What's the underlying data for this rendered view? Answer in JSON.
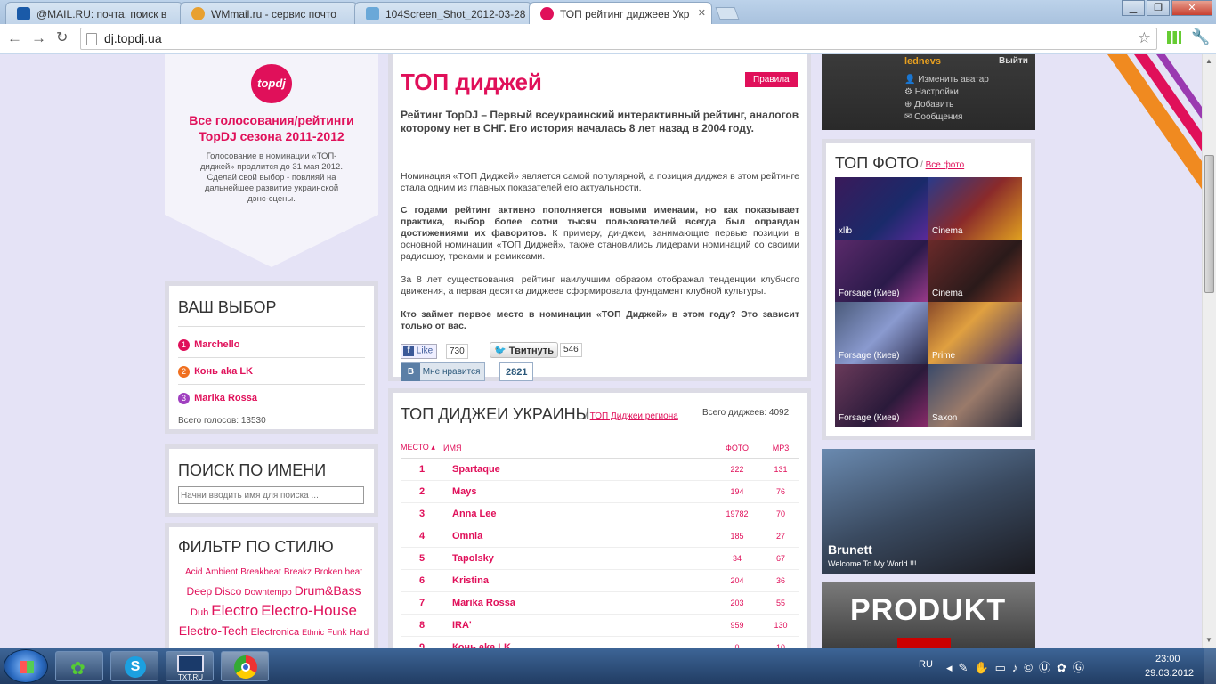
{
  "browser": {
    "tabs": [
      {
        "label": "@MAIL.RU: почта, поиск в"
      },
      {
        "label": "WMmail.ru - сервис почто"
      },
      {
        "label": "104Screen_Shot_2012-03-28"
      },
      {
        "label": "ТОП рейтинг диджеев Укр"
      }
    ],
    "url": "dj.topdj.ua"
  },
  "left": {
    "promo": {
      "logo": "topdj",
      "title": "Все голосования/рейтинги TopDJ сезона 2011-2012",
      "text": "Голосование в номинации «ТОП-диджей» продлится до 31 мая 2012. Сделай свой выбор - повлияй на дальнейшее развитие украинской дэнс-сцены."
    },
    "choice": {
      "title": "ВАШ ВЫБОР",
      "items": [
        {
          "num": "1",
          "name": "Marchello",
          "color": "#e0105a"
        },
        {
          "num": "2",
          "name": "Конь aka LK",
          "color": "#f07020"
        },
        {
          "num": "3",
          "name": "Marika Rossa",
          "color": "#a040c0"
        }
      ],
      "total": "Всего голосов: 13530"
    },
    "search": {
      "title": "ПОИСК ПО ИМЕНИ",
      "placeholder": "Начни вводить имя для поиска ..."
    },
    "filter": {
      "title": "ФИЛЬТР ПО СТИЛЮ",
      "tags": [
        "Acid",
        "Ambient",
        "Breakbeat",
        "Breakz",
        "Broken beat",
        "Deep",
        "Disco",
        "Downtempo",
        "Drum&Bass",
        "Dub",
        "Electro",
        "Electro-House",
        "Electro-Tech",
        "Electronica",
        "Ethnic",
        "Funk",
        "Hard"
      ]
    }
  },
  "main": {
    "title": "ТОП диджей",
    "rules_btn": "Правила",
    "lead": "Рейтинг TopDJ – Первый всеукраинский интерактивный рейтинг, аналогов которому нет в СНГ. Его история началась 8 лет назад в 2004 году.",
    "p1": "Номинация «ТОП Диджей» является самой популярной, а позиция диджея в этом рейтинге стала одним из главных показателей его актуальности.",
    "p2_bold": "С годами рейтинг активно пополняется новыми именами, но как показывает практика, выбор более сотни тысяч пользователей всегда был оправдан достижениями их фаворитов.",
    "p2_rest": " К примеру, ди-джеи, занимающие первые позиции в основной номинации «ТОП Диджей», также становились лидерами номинаций со своими радиошоу, треками и ремиксами.",
    "p3": "За 8 лет существования, рейтинг наилучшим образом отображал тенденции клубного движения, а первая десятка диджеев сформировала фундамент клубной культуры.",
    "p4": "Кто займет первое место в номинации «ТОП Диджей» в этом году? Это зависит только от вас.",
    "social": {
      "fb_label": "Like",
      "fb_count": "730",
      "tw_label": "Твитнуть",
      "tw_count": "546",
      "vk_label": "Мне нравится",
      "vk_count": "2821"
    }
  },
  "ranking": {
    "title": "ТОП ДИДЖЕИ УКРАИНЫ",
    "link": "ТОП Диджеи региона",
    "total": "Всего диджеев: 4092",
    "cols": {
      "place": "МЕСТО",
      "name": "ИМЯ",
      "photo": "ФОТО",
      "mp3": "MP3"
    },
    "rows": [
      {
        "place": "1",
        "name": "Spartaque",
        "photo": "222",
        "mp3": "131"
      },
      {
        "place": "2",
        "name": "Mays",
        "photo": "194",
        "mp3": "76"
      },
      {
        "place": "3",
        "name": "Anna Lee",
        "photo": "19782",
        "mp3": "70"
      },
      {
        "place": "4",
        "name": "Omnia",
        "photo": "185",
        "mp3": "27"
      },
      {
        "place": "5",
        "name": "Tapolsky",
        "photo": "34",
        "mp3": "67"
      },
      {
        "place": "6",
        "name": "Kristina",
        "photo": "204",
        "mp3": "36"
      },
      {
        "place": "7",
        "name": "Marika Rossa",
        "photo": "203",
        "mp3": "55"
      },
      {
        "place": "8",
        "name": "IRA'",
        "photo": "959",
        "mp3": "130"
      },
      {
        "place": "9",
        "name": "Конь aka LK",
        "photo": "0",
        "mp3": "10"
      }
    ]
  },
  "right": {
    "user": {
      "name": "lednevs",
      "logout": "Выйти",
      "menu": [
        "Изменить аватар",
        "Настройки",
        "Добавить",
        "Сообщения"
      ]
    },
    "photos": {
      "title": "ТОП ФОТО",
      "all": "Все фото",
      "items": [
        {
          "caption": "xlib",
          "color": "#3a1a5a"
        },
        {
          "caption": "Cinema",
          "color": "#2a3a8a"
        },
        {
          "caption": "Forsage (Киев)",
          "color": "#5a2a6a"
        },
        {
          "caption": "Cinema",
          "color": "#6a2a2a"
        },
        {
          "caption": "Forsage (Киев)",
          "color": "#4a5a7a"
        },
        {
          "caption": "Prime",
          "color": "#8a4a2a"
        },
        {
          "caption": "Forsage (Киев)",
          "color": "#6a3a5a"
        },
        {
          "caption": "Saxon",
          "color": "#3a4a6a"
        }
      ]
    },
    "promo1": {
      "name": "Brunett",
      "sub": "Welcome To My World !!!"
    },
    "promo2": {
      "text": "PRODUKT"
    }
  },
  "taskbar": {
    "lang": "RU",
    "time": "23:00",
    "date": "29.03.2012",
    "pinned": [
      "ICQ",
      "Skype",
      "TXT.RU",
      "Chrome"
    ]
  }
}
